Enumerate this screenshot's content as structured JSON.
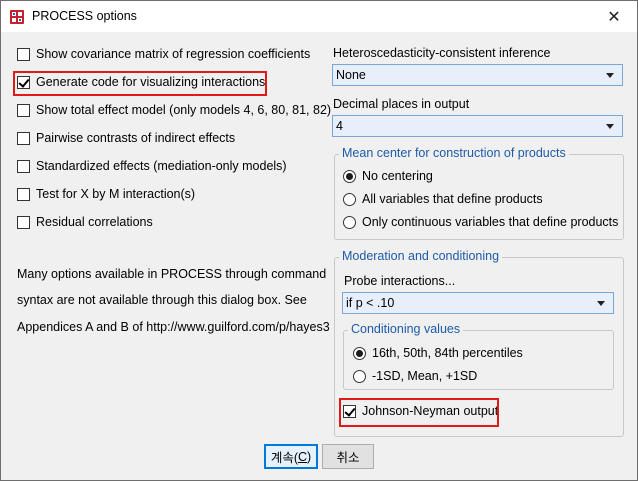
{
  "window": {
    "title": "PROCESS options",
    "close_glyph": "✕"
  },
  "checkboxes": [
    {
      "label": "Show covariance matrix of regression coefficients",
      "checked": false
    },
    {
      "label": "Generate code for visualizing interactions",
      "checked": true
    },
    {
      "label": "Show total effect model (only models 4, 6, 80, 81, 82)",
      "checked": false
    },
    {
      "label": "Pairwise contrasts of indirect effects",
      "checked": false
    },
    {
      "label": "Standardized effects (mediation-only models)",
      "checked": false
    },
    {
      "label": "Test for X by M interaction(s)",
      "checked": false
    },
    {
      "label": "Residual correlations",
      "checked": false
    }
  ],
  "info_text": [
    "Many options available in PROCESS through command",
    "syntax are not available through this dialog box.  See",
    "Appendices A and B of http://www.guilford.com/p/hayes3"
  ],
  "hc_inference": {
    "label": "Heteroscedasticity-consistent inference",
    "value": "None"
  },
  "decimal_places": {
    "label": "Decimal places in output",
    "value": "4"
  },
  "mean_center": {
    "legend": "Mean center for construction of products",
    "options": [
      {
        "label": "No centering",
        "selected": true
      },
      {
        "label": "All variables that define products",
        "selected": false
      },
      {
        "label": "Only continuous variables that define products",
        "selected": false
      }
    ]
  },
  "moderation": {
    "legend": "Moderation and conditioning",
    "probe_label": "Probe interactions...",
    "probe_value": "if p < .10",
    "conditioning": {
      "legend": "Conditioning values",
      "options": [
        {
          "label": "16th, 50th, 84th percentiles",
          "selected": true
        },
        {
          "label": "-1SD, Mean, +1SD",
          "selected": false
        }
      ]
    },
    "johnson_neyman": {
      "label": "Johnson-Neyman output",
      "checked": true
    }
  },
  "buttons": {
    "continue_prefix": "계속(",
    "continue_key": "C",
    "continue_suffix": ")",
    "cancel": "취소"
  },
  "colors": {
    "highlight": "#e01919",
    "group_legend": "#1d5aa8",
    "default_button_border": "#0078d7"
  }
}
